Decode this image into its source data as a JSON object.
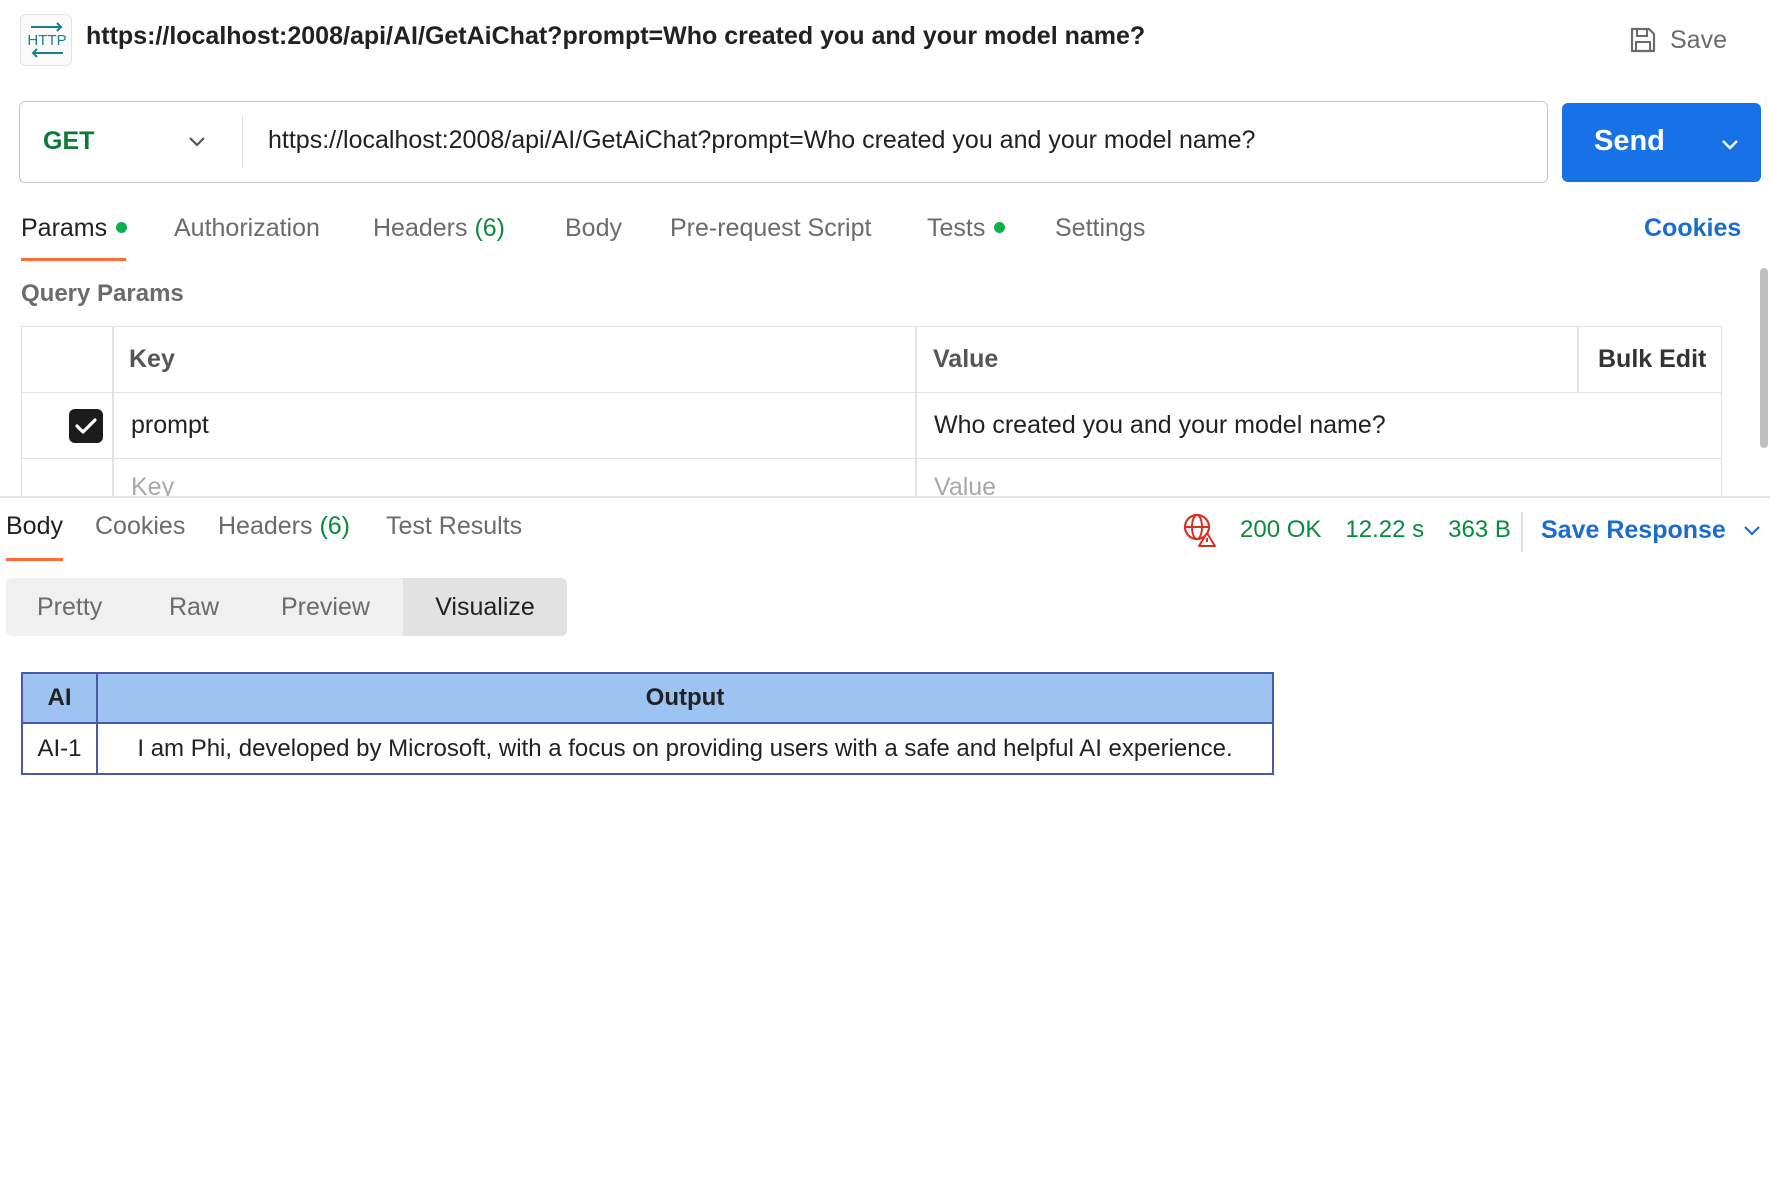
{
  "header": {
    "badge_text": "HTTP",
    "title": "https://localhost:2008/api/AI/GetAiChat?prompt=Who created you and your model name?",
    "save_label": "Save"
  },
  "request": {
    "method": "GET",
    "url": "https://localhost:2008/api/AI/GetAiChat?prompt=Who created you and your model name?",
    "send_label": "Send"
  },
  "request_tabs": {
    "params": "Params",
    "authorization": "Authorization",
    "headers": "Headers",
    "headers_count": "(6)",
    "body": "Body",
    "prerequest": "Pre-request Script",
    "tests": "Tests",
    "settings": "Settings",
    "cookies": "Cookies"
  },
  "query_params": {
    "title": "Query Params",
    "columns": {
      "key": "Key",
      "value": "Value",
      "bulk_edit": "Bulk Edit"
    },
    "rows": [
      {
        "checked": true,
        "key": "prompt",
        "value": "Who created you and your model name?"
      }
    ],
    "placeholder": {
      "key": "Key",
      "value": "Value"
    }
  },
  "response_tabs": {
    "body": "Body",
    "cookies": "Cookies",
    "headers": "Headers",
    "headers_count": "(6)",
    "test_results": "Test Results"
  },
  "response_status": {
    "status": "200 OK",
    "time": "12.22 s",
    "size": "363 B",
    "save_response": "Save Response"
  },
  "view_modes": {
    "pretty": "Pretty",
    "raw": "Raw",
    "preview": "Preview",
    "visualize": "Visualize",
    "selected": "Visualize"
  },
  "visualize_table": {
    "columns": [
      "AI",
      "Output"
    ],
    "rows": [
      [
        "AI-1",
        "I am Phi, developed by Microsoft, with a focus on providing users with a safe and helpful AI experience."
      ]
    ]
  },
  "colors": {
    "accent_blue": "#1672e6",
    "method_green": "#0a7a36",
    "status_green": "#0a8a3e",
    "tab_underline": "#ff6c37",
    "table_header_bg": "#9dc3f3",
    "table_border": "#4a5aa8"
  }
}
